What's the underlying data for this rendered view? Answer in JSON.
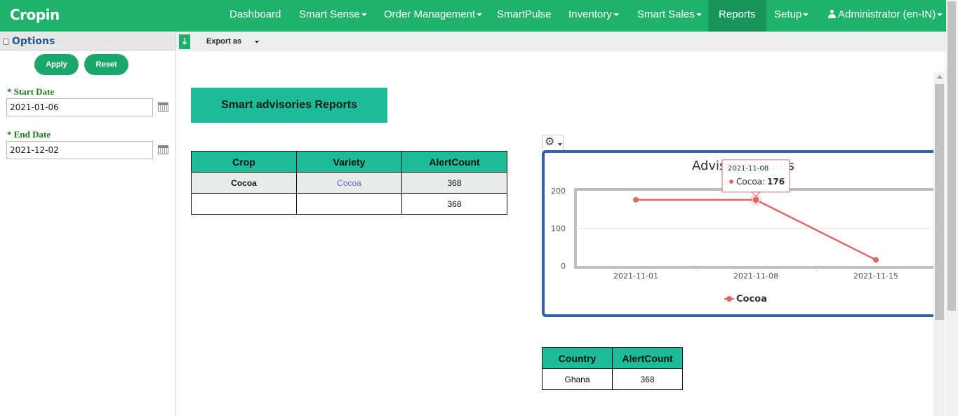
{
  "app": {
    "logo": "Cropin"
  },
  "nav": {
    "items": [
      {
        "label": "Dashboard",
        "caret": false
      },
      {
        "label": "Smart Sense",
        "caret": true
      },
      {
        "label": "Order Management",
        "caret": true
      },
      {
        "label": "SmartPulse",
        "caret": false
      },
      {
        "label": "Inventory",
        "caret": true
      },
      {
        "label": "Smart Sales",
        "caret": true
      },
      {
        "label": "Reports",
        "caret": false,
        "active": true
      },
      {
        "label": "Setup",
        "caret": true
      }
    ],
    "user_label": "Administrator (en-IN)",
    "colors": {
      "bar": "#20b26b",
      "active": "#18955a"
    }
  },
  "sidebar": {
    "title": "Options",
    "apply_label": "Apply",
    "reset_label": "Reset",
    "start_date_label": "* Start Date",
    "start_date_value": "2021-01-06",
    "end_date_label": "* End Date",
    "end_date_value": "2021-12-02"
  },
  "toolbar": {
    "export_label": "Export as"
  },
  "report": {
    "title": "Smart advisories Reports",
    "crop_table": {
      "headers": [
        "Crop",
        "Variety",
        "AlertCount"
      ],
      "rows": [
        [
          "Cocoa",
          "Cocoa",
          "368"
        ],
        [
          "",
          "",
          "368"
        ]
      ]
    },
    "country_table": {
      "headers": [
        "Country",
        "AlertCount"
      ],
      "rows": [
        [
          "Ghana",
          "368"
        ]
      ]
    }
  },
  "chart_data": {
    "type": "line",
    "title": "Advisory Counts",
    "x": [
      "2021-11-01",
      "2021-11-08",
      "2021-11-15"
    ],
    "series": [
      {
        "name": "Cocoa",
        "values": [
          176,
          176,
          16
        ],
        "color": "#e06666"
      }
    ],
    "y_ticks": [
      0,
      100,
      200
    ],
    "ylim": [
      0,
      200
    ],
    "legend": "bottom-center",
    "tooltip": {
      "date": "2021-11-08",
      "series": "Cocoa",
      "value": "176"
    }
  }
}
